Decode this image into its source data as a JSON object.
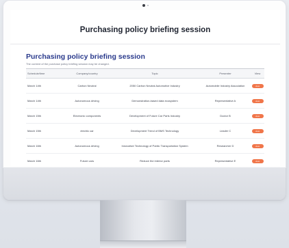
{
  "page_title": "Purchasing policy briefing session",
  "section": {
    "title": "Purchasing policy briefing session",
    "subtitle": "The content of the purchase policy briefing session may be changed."
  },
  "table": {
    "headers": [
      "Schedule/time",
      "Company/country",
      "Topic",
      "Presenter",
      "View"
    ],
    "rows": [
      {
        "date": "March 14th",
        "company": "Carbon Neutral",
        "topic": "2050 Carbon Neutral Automotive Industry",
        "presenter": "Automobile Industry Association",
        "view": "view"
      },
      {
        "date": "March 14th",
        "company": "Autonomous driving",
        "topic": "Demonstration-based data ecosystem",
        "presenter": "Representative A",
        "view": "view"
      },
      {
        "date": "March 15th",
        "company": "Electronic components",
        "topic": "Development of Future Car Parts Industry",
        "presenter": "Doctor B",
        "view": "view"
      },
      {
        "date": "March 15th",
        "company": "electric car",
        "topic": "Development Trend of BMS Technology",
        "presenter": "Leader C",
        "view": "view"
      },
      {
        "date": "March 16th",
        "company": "Autonomous driving",
        "topic": "Innovative Technology of Public Transportation System",
        "presenter": "Researcher D",
        "view": "view"
      },
      {
        "date": "March 16th",
        "company": "Future cars",
        "topic": "Reduce the interior parts",
        "presenter": "Representative E",
        "view": "view"
      }
    ]
  },
  "colors": {
    "accent": "#f0764a",
    "section_title": "#2a3a8c"
  }
}
